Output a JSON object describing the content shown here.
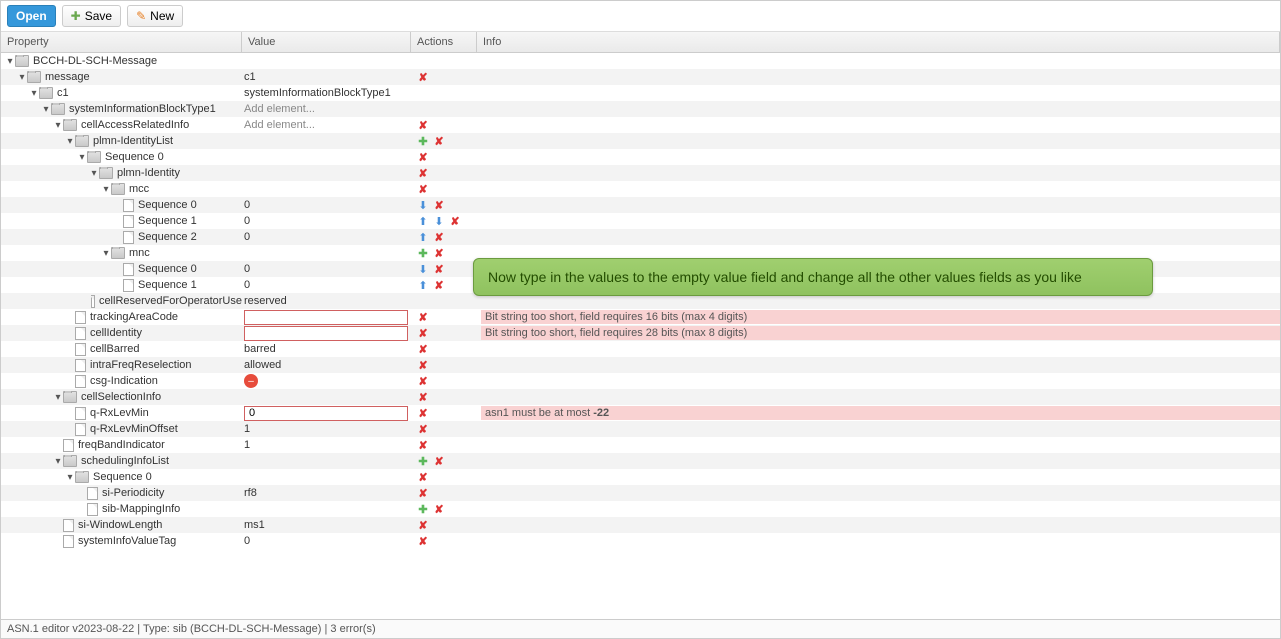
{
  "toolbar": {
    "open": "Open",
    "save": "Save",
    "new": "New"
  },
  "columns": {
    "property": "Property",
    "value": "Value",
    "actions": "Actions",
    "info": "Info"
  },
  "rows": [
    {
      "indent": 0,
      "toggle": true,
      "icon": "folder",
      "label": "BCCH-DL-SCH-Message",
      "value": "",
      "actions": [],
      "info": "",
      "alt": false
    },
    {
      "indent": 1,
      "toggle": true,
      "icon": "folder",
      "label": "message",
      "value": "c1",
      "actions": [
        "del"
      ],
      "info": "",
      "alt": true
    },
    {
      "indent": 2,
      "toggle": true,
      "icon": "folder",
      "label": "c1",
      "value": "systemInformationBlockType1",
      "actions": [],
      "info": "",
      "alt": false
    },
    {
      "indent": 3,
      "toggle": true,
      "icon": "folder",
      "label": "systemInformationBlockType1",
      "value": "Add element...",
      "actions": [],
      "info": "",
      "alt": true
    },
    {
      "indent": 4,
      "toggle": true,
      "icon": "folder",
      "label": "cellAccessRelatedInfo",
      "value": "Add element...",
      "actions": [
        "del"
      ],
      "info": "",
      "alt": false
    },
    {
      "indent": 5,
      "toggle": true,
      "icon": "folder",
      "label": "plmn-IdentityList",
      "value": "",
      "actions": [
        "add",
        "del"
      ],
      "info": "",
      "alt": true
    },
    {
      "indent": 6,
      "toggle": true,
      "icon": "folder",
      "label": "Sequence 0",
      "value": "",
      "actions": [
        "del"
      ],
      "info": "",
      "alt": false
    },
    {
      "indent": 7,
      "toggle": true,
      "icon": "folder",
      "label": "plmn-Identity",
      "value": "",
      "actions": [
        "del"
      ],
      "info": "",
      "alt": true
    },
    {
      "indent": 8,
      "toggle": true,
      "icon": "folder",
      "label": "mcc",
      "value": "",
      "actions": [
        "del"
      ],
      "info": "",
      "alt": false
    },
    {
      "indent": 9,
      "toggle": false,
      "icon": "file",
      "label": "Sequence 0",
      "value": "0",
      "actions": [
        "down",
        "del"
      ],
      "info": "",
      "alt": true
    },
    {
      "indent": 9,
      "toggle": false,
      "icon": "file",
      "label": "Sequence 1",
      "value": "0",
      "actions": [
        "up",
        "down",
        "del"
      ],
      "info": "",
      "alt": false
    },
    {
      "indent": 9,
      "toggle": false,
      "icon": "file",
      "label": "Sequence 2",
      "value": "0",
      "actions": [
        "up",
        "del"
      ],
      "info": "",
      "alt": true
    },
    {
      "indent": 8,
      "toggle": true,
      "icon": "folder",
      "label": "mnc",
      "value": "",
      "actions": [
        "add",
        "del"
      ],
      "info": "",
      "alt": false
    },
    {
      "indent": 9,
      "toggle": false,
      "icon": "file",
      "label": "Sequence 0",
      "value": "0",
      "actions": [
        "down",
        "del"
      ],
      "info": "",
      "alt": true
    },
    {
      "indent": 9,
      "toggle": false,
      "icon": "file",
      "label": "Sequence 1",
      "value": "0",
      "actions": [
        "up",
        "del"
      ],
      "info": "",
      "alt": false
    },
    {
      "indent": 7,
      "toggle": false,
      "icon": "file",
      "label": "cellReservedForOperatorUse",
      "value": "reserved",
      "actions": [],
      "info": "",
      "alt": true
    },
    {
      "indent": 5,
      "toggle": false,
      "icon": "file",
      "label": "trackingAreaCode",
      "value": "",
      "input": true,
      "actions": [
        "del"
      ],
      "info": "Bit string too short, field requires 16 bits (max 4 digits)",
      "err": true,
      "alt": false
    },
    {
      "indent": 5,
      "toggle": false,
      "icon": "file",
      "label": "cellIdentity",
      "value": "",
      "input": true,
      "actions": [
        "del"
      ],
      "info": "Bit string too short, field requires 28 bits (max 8 digits)",
      "err": true,
      "alt": true
    },
    {
      "indent": 5,
      "toggle": false,
      "icon": "file",
      "label": "cellBarred",
      "value": "barred",
      "actions": [
        "del"
      ],
      "info": "",
      "alt": false
    },
    {
      "indent": 5,
      "toggle": false,
      "icon": "file",
      "label": "intraFreqReselection",
      "value": "allowed",
      "actions": [
        "del"
      ],
      "info": "",
      "alt": true
    },
    {
      "indent": 5,
      "toggle": false,
      "icon": "file",
      "label": "csg-Indication",
      "value": "",
      "deny": true,
      "actions": [
        "del"
      ],
      "info": "",
      "alt": false
    },
    {
      "indent": 4,
      "toggle": true,
      "icon": "folder",
      "label": "cellSelectionInfo",
      "value": "",
      "actions": [
        "del"
      ],
      "info": "",
      "alt": true
    },
    {
      "indent": 5,
      "toggle": false,
      "icon": "file",
      "label": "q-RxLevMin",
      "value": "0",
      "input": true,
      "actions": [
        "del"
      ],
      "info": "asn1 must be at most -22",
      "err": true,
      "alt": false
    },
    {
      "indent": 5,
      "toggle": false,
      "icon": "file",
      "label": "q-RxLevMinOffset",
      "value": "1",
      "actions": [
        "del"
      ],
      "info": "",
      "alt": true
    },
    {
      "indent": 4,
      "toggle": false,
      "icon": "file",
      "label": "freqBandIndicator",
      "value": "1",
      "actions": [
        "del"
      ],
      "info": "",
      "alt": false
    },
    {
      "indent": 4,
      "toggle": true,
      "icon": "folder",
      "label": "schedulingInfoList",
      "value": "",
      "actions": [
        "add",
        "del"
      ],
      "info": "",
      "alt": true
    },
    {
      "indent": 5,
      "toggle": true,
      "icon": "folder",
      "label": "Sequence 0",
      "value": "",
      "actions": [
        "del"
      ],
      "info": "",
      "alt": false
    },
    {
      "indent": 6,
      "toggle": false,
      "icon": "file",
      "label": "si-Periodicity",
      "value": "rf8",
      "actions": [
        "del"
      ],
      "info": "",
      "alt": true
    },
    {
      "indent": 6,
      "toggle": false,
      "icon": "file",
      "label": "sib-MappingInfo",
      "value": "",
      "actions": [
        "add",
        "del"
      ],
      "info": "",
      "alt": false
    },
    {
      "indent": 4,
      "toggle": false,
      "icon": "file",
      "label": "si-WindowLength",
      "value": "ms1",
      "actions": [
        "del"
      ],
      "info": "",
      "alt": true
    },
    {
      "indent": 4,
      "toggle": false,
      "icon": "file",
      "label": "systemInfoValueTag",
      "value": "0",
      "actions": [
        "del"
      ],
      "info": "",
      "alt": false
    }
  ],
  "callout": "Now type in the values to the empty value field and change all the other values fields as you like",
  "status": "ASN.1 editor v2023-08-22 | Type: sib (BCCH-DL-SCH-Message) | 3 error(s)"
}
